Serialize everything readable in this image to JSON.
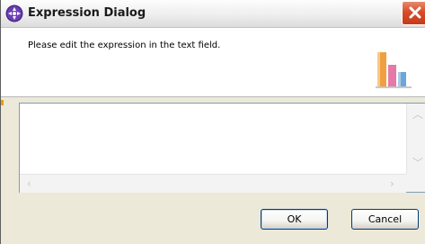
{
  "window": {
    "title": "Expression Dialog"
  },
  "header": {
    "message": "Please edit the expression in the text field."
  },
  "editor": {
    "value": ""
  },
  "buttons": {
    "ok_label": "OK",
    "cancel_label": "Cancel"
  },
  "icons": {
    "app": "eclipse-app-icon",
    "close": "close-icon",
    "banner": "bar-chart-icon"
  },
  "colors": {
    "close_button": "#d64d2b",
    "banner_bar_orange": "#f0a040",
    "banner_bar_blue": "#6ea6d8"
  }
}
